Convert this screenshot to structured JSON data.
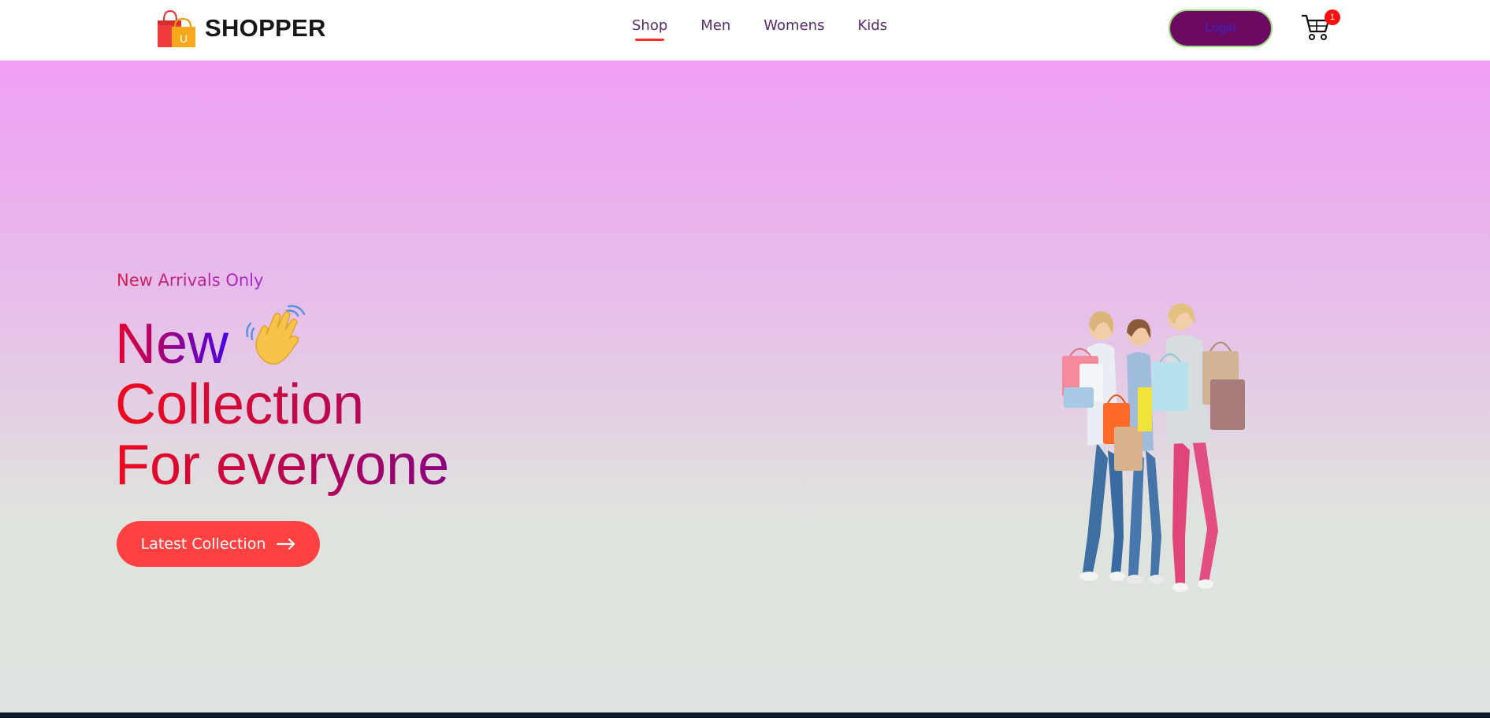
{
  "navbar": {
    "brand": "SHOPPER",
    "menu": [
      {
        "label": "Shop",
        "active": true
      },
      {
        "label": "Men",
        "active": false
      },
      {
        "label": "Womens",
        "active": false
      },
      {
        "label": "Kids",
        "active": false
      }
    ],
    "login_label": "Login",
    "cart_count": "1"
  },
  "hero": {
    "kicker": "New Arrivals Only",
    "headline_line1": "New",
    "headline_line2": "Collection",
    "headline_line3": "For everyone",
    "cta_label": "Latest Collection",
    "icons": [
      "shopping-bag-logo-icon",
      "cart-icon",
      "waving-hand-icon",
      "arrow-right-icon"
    ]
  },
  "colors": {
    "accent": "#ff4141",
    "login_bg": "#6c0a63",
    "hero_top": "#f09ff6",
    "hero_bottom": "#dde3df",
    "badge": "#ff1010"
  }
}
